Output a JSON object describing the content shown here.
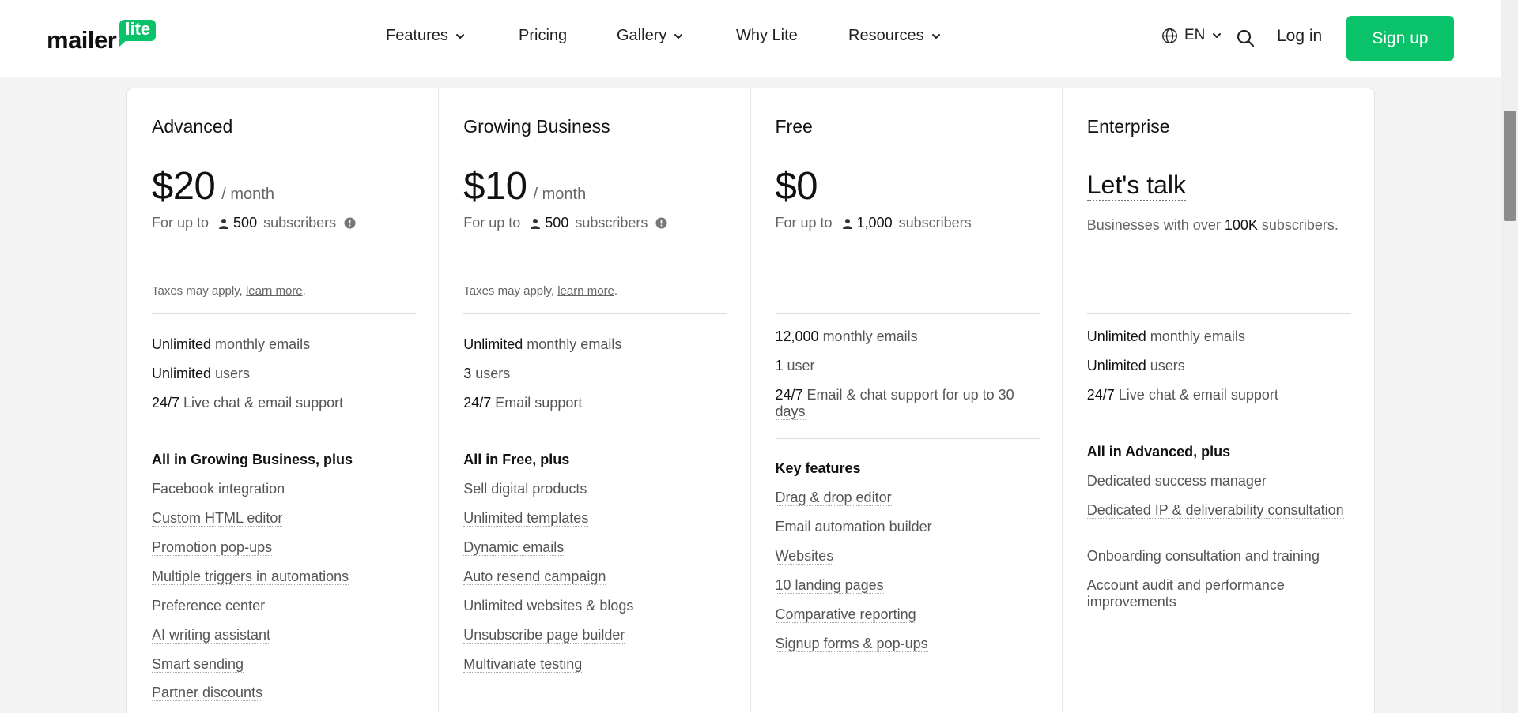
{
  "header": {
    "logo_word": "mailer",
    "logo_badge": "lite",
    "nav": [
      {
        "label": "Features",
        "dropdown": true
      },
      {
        "label": "Pricing",
        "dropdown": false
      },
      {
        "label": "Gallery",
        "dropdown": true
      },
      {
        "label": "Why Lite",
        "dropdown": false
      },
      {
        "label": "Resources",
        "dropdown": true
      }
    ],
    "language": "EN",
    "login_label": "Log in",
    "signup_label": "Sign up"
  },
  "colors": {
    "brand_green": "#09c269"
  },
  "plans": [
    {
      "name": "Advanced",
      "price": "$20",
      "per": "/ month",
      "subs_prefix": "For up to",
      "subs_count": "500",
      "subs_suffix": "subscribers",
      "taxes_text": "Taxes may apply, ",
      "taxes_link": "learn more",
      "limits": [
        {
          "bold": "Unlimited",
          "rest": " monthly emails",
          "underline": false
        },
        {
          "bold": "Unlimited",
          "rest": " users",
          "underline": false
        },
        {
          "bold": "24/7",
          "rest": " Live chat & email support",
          "underline": true
        }
      ],
      "section_title": "All in Growing Business, plus",
      "features": [
        "Facebook integration",
        "Custom HTML editor",
        "Promotion pop-ups",
        "Multiple triggers in automations",
        "Preference center",
        "AI writing assistant",
        "Smart sending",
        "Partner discounts"
      ]
    },
    {
      "name": "Growing Business",
      "price": "$10",
      "per": "/ month",
      "subs_prefix": "For up to",
      "subs_count": "500",
      "subs_suffix": "subscribers",
      "taxes_text": "Taxes may apply, ",
      "taxes_link": "learn more",
      "limits": [
        {
          "bold": "Unlimited",
          "rest": " monthly emails",
          "underline": false
        },
        {
          "bold": "3",
          "rest": " users",
          "underline": false
        },
        {
          "bold": "24/7",
          "rest": " Email support",
          "underline": true
        }
      ],
      "section_title": "All in Free, plus",
      "features": [
        "Sell digital products",
        "Unlimited templates",
        "Dynamic emails",
        "Auto resend campaign",
        "Unlimited websites & blogs",
        "Unsubscribe page builder",
        "Multivariate testing"
      ]
    },
    {
      "name": "Free",
      "price": "$0",
      "subs_prefix": "For up to",
      "subs_count": "1,000",
      "subs_suffix": "subscribers",
      "limits": [
        {
          "bold": "12,000",
          "rest": " monthly emails",
          "underline": false
        },
        {
          "bold": "1",
          "rest": " user",
          "underline": false
        },
        {
          "bold": "24/7",
          "rest": " Email & chat support for up to 30 days",
          "underline": true
        }
      ],
      "section_title": "Key features",
      "features": [
        "Drag & drop editor",
        "Email automation builder",
        "Websites",
        "10 landing pages",
        "Comparative reporting",
        "Signup forms & pop-ups"
      ]
    },
    {
      "name": "Enterprise",
      "cta": "Let's talk",
      "desc_before": "Businesses with over ",
      "desc_bold": "100K",
      "desc_after": " subscribers.",
      "limits": [
        {
          "bold": "Unlimited",
          "rest": " monthly emails",
          "underline": false
        },
        {
          "bold": "Unlimited",
          "rest": " users",
          "underline": false
        },
        {
          "bold": "24/7",
          "rest": " Live chat & email support",
          "underline": true
        }
      ],
      "section_title": "All in Advanced, plus",
      "features": [
        "Dedicated success manager",
        "Dedicated IP & deliverability consultation",
        "Onboarding consultation and training",
        "Account audit and performance improvements"
      ]
    }
  ]
}
